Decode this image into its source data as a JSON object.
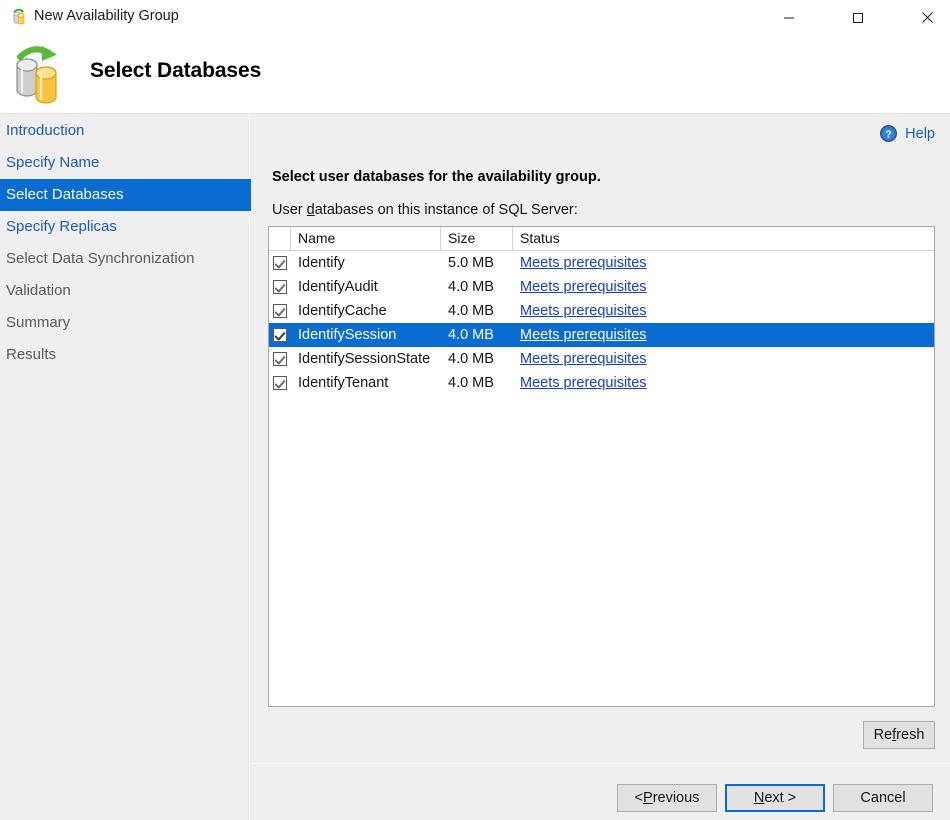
{
  "window": {
    "title": "New Availability Group",
    "icon": "availability-group-icon",
    "controls": {
      "minimize": "minimize-icon",
      "maximize": "maximize-icon",
      "close": "close-icon"
    }
  },
  "banner": {
    "title": "Select Databases",
    "icon": "database-replication-icon"
  },
  "sidebar": {
    "items": [
      {
        "label": "Introduction",
        "state": "link"
      },
      {
        "label": "Specify Name",
        "state": "link"
      },
      {
        "label": "Select Databases",
        "state": "active"
      },
      {
        "label": "Specify Replicas",
        "state": "link"
      },
      {
        "label": "Select Data Synchronization",
        "state": "disabled"
      },
      {
        "label": "Validation",
        "state": "disabled"
      },
      {
        "label": "Summary",
        "state": "disabled"
      },
      {
        "label": "Results",
        "state": "disabled"
      }
    ]
  },
  "content": {
    "help_label": "Help",
    "help_icon": "help-circle-icon",
    "lead": "Select user databases for the availability group.",
    "sublead_before": "User ",
    "sublead_accesskey": "d",
    "sublead_after": "atabases on this instance of SQL Server:",
    "table": {
      "columns": [
        "",
        "Name",
        "Size",
        "Status"
      ],
      "rows": [
        {
          "checked": true,
          "name": "Identify",
          "size": "5.0 MB",
          "status": "Meets prerequisites",
          "selected": false
        },
        {
          "checked": true,
          "name": "IdentifyAudit",
          "size": "4.0 MB",
          "status": "Meets prerequisites",
          "selected": false
        },
        {
          "checked": true,
          "name": "IdentifyCache",
          "size": "4.0 MB",
          "status": "Meets prerequisites",
          "selected": false
        },
        {
          "checked": true,
          "name": "IdentifySession",
          "size": "4.0 MB",
          "status": "Meets prerequisites",
          "selected": true
        },
        {
          "checked": true,
          "name": "IdentifySessionState",
          "size": "4.0 MB",
          "status": "Meets prerequisites",
          "selected": false
        },
        {
          "checked": true,
          "name": "IdentifyTenant",
          "size": "4.0 MB",
          "status": "Meets prerequisites",
          "selected": false
        }
      ]
    },
    "refresh": {
      "before": "Re",
      "accesskey": "f",
      "after": "resh"
    }
  },
  "footer": {
    "previous": {
      "before": "< ",
      "accesskey": "P",
      "after": "revious"
    },
    "next": {
      "before": "",
      "accesskey": "N",
      "after": "ext >"
    },
    "cancel": {
      "before": "Cancel",
      "accesskey": "",
      "after": ""
    }
  },
  "colors": {
    "accent": "#0a6cd0",
    "link": "#1a5bb8",
    "status_link": "#1a3fbd",
    "panel": "#efefef",
    "disabled_text": "#5a5a5a"
  }
}
